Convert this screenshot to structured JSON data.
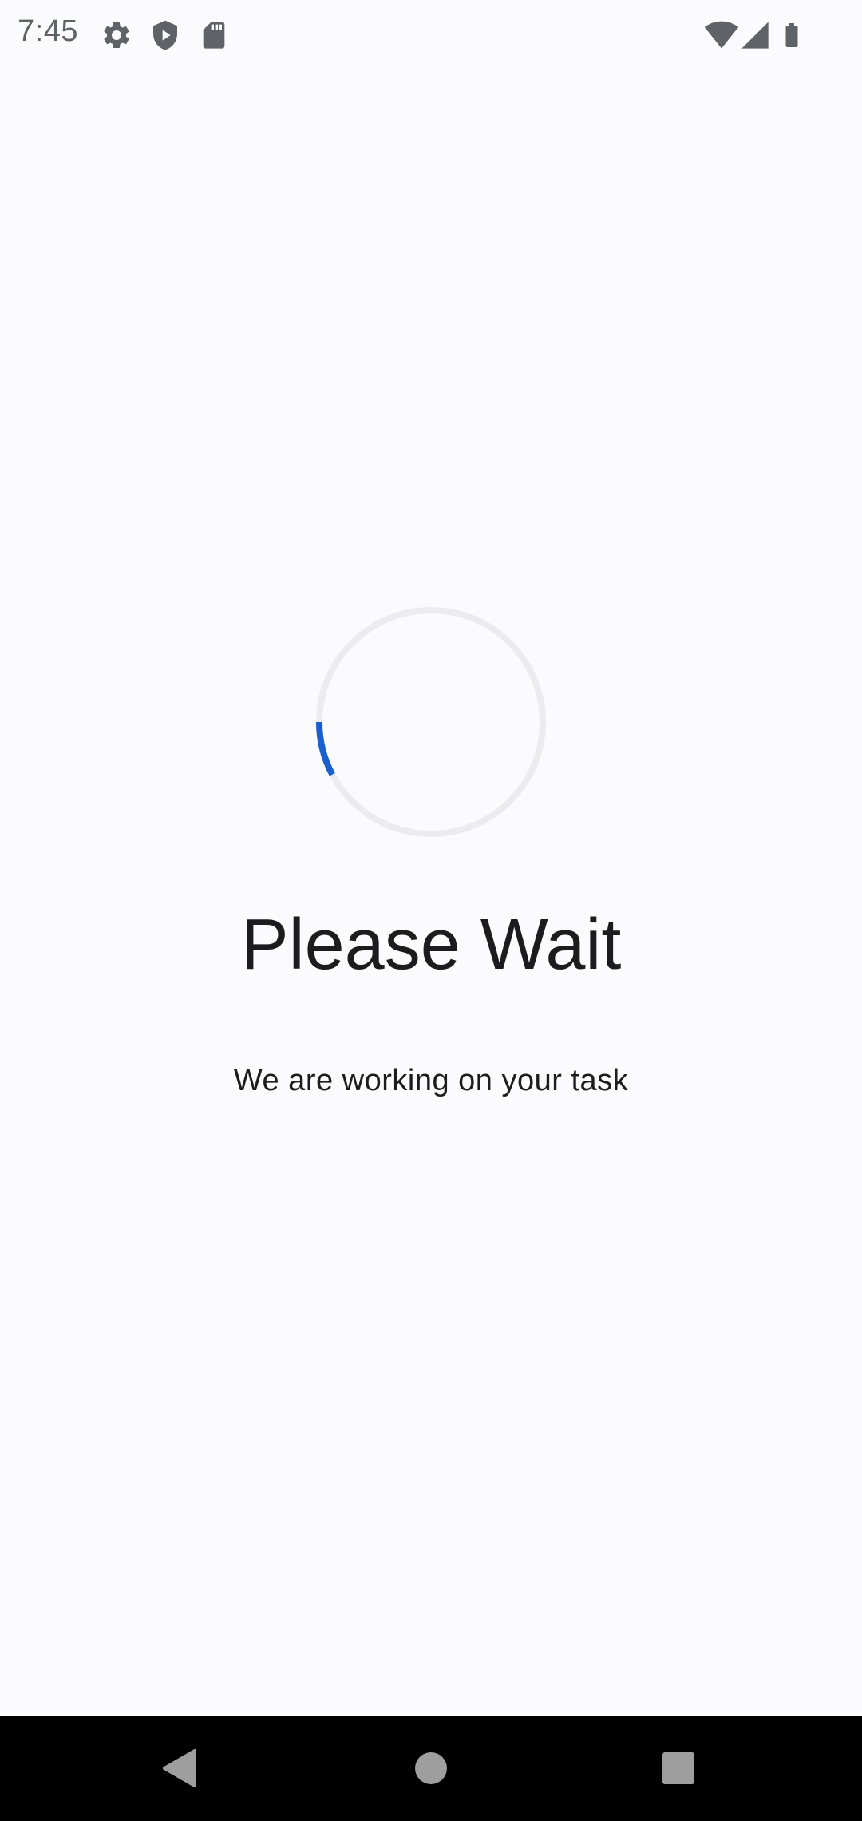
{
  "status_bar": {
    "time": "7:45",
    "left_icons": [
      "gear-icon",
      "shield-play-icon",
      "sd-card-icon"
    ],
    "right_icons": [
      "wifi-icon",
      "cell-signal-icon",
      "battery-icon"
    ],
    "icon_color": "#5f6368"
  },
  "loading": {
    "title": "Please Wait",
    "message": "We are working on your task",
    "spinner_track_color": "#ECECEE",
    "spinner_arc_color": "#1A5FD0"
  },
  "nav_bar": {
    "buttons": [
      "back-icon",
      "home-icon",
      "recents-icon"
    ],
    "button_color": "#9E9E9E"
  }
}
